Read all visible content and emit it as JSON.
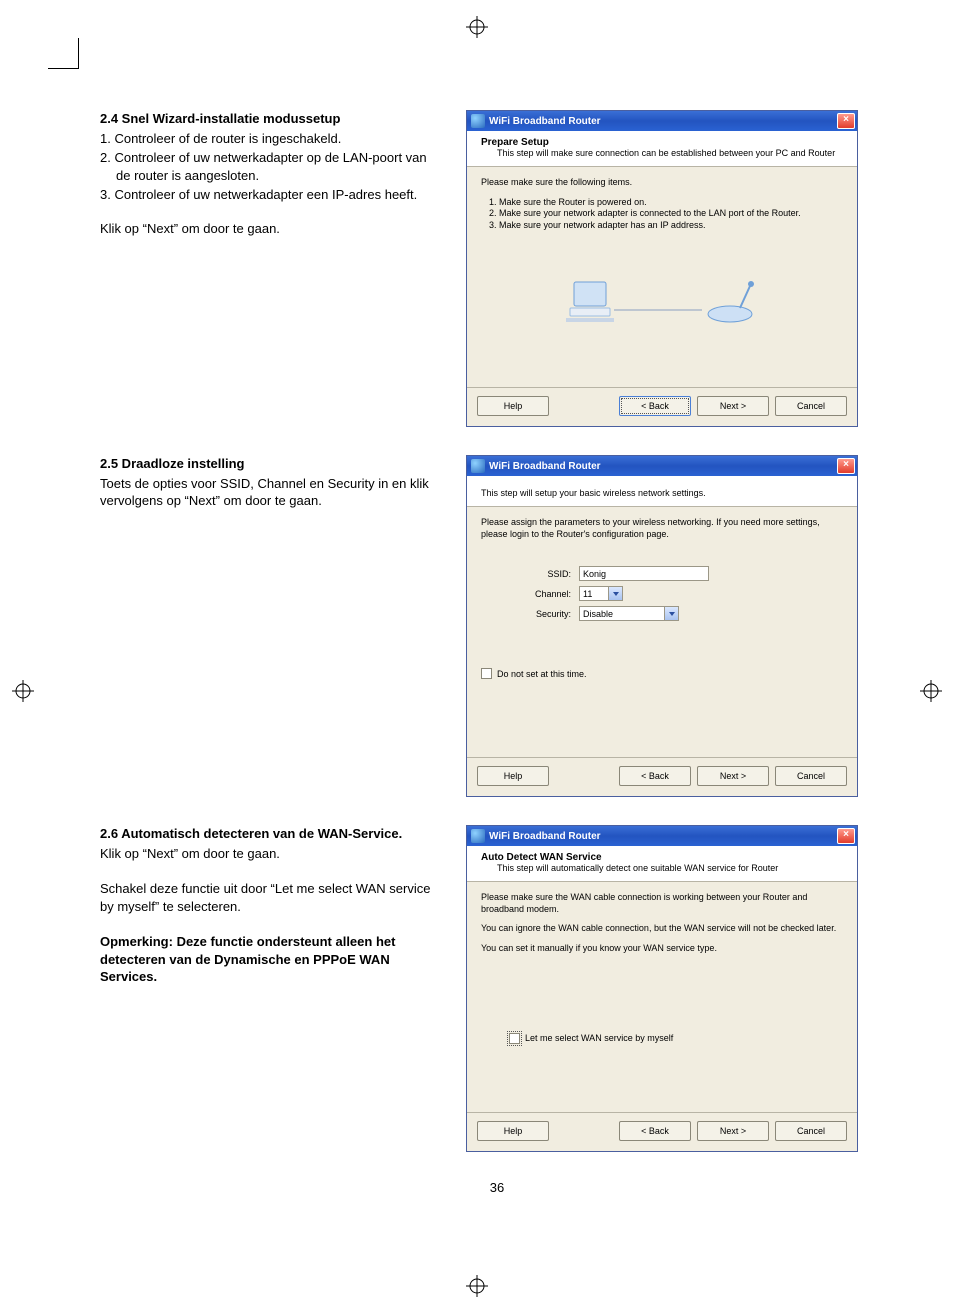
{
  "page_number": "36",
  "sections": {
    "s24": {
      "heading": "2.4 Snel Wizard-installatie modussetup",
      "items": [
        "1. Controleer of de router is ingeschakeld.",
        "2. Controleer of uw netwerkadapter op de LAN-poort van de router is aangesloten.",
        "3. Controleer of uw netwerkadapter een IP-adres heeft."
      ],
      "next": "Klik op “Next” om door te gaan."
    },
    "s25": {
      "heading": "2.5 Draadloze instelling",
      "body": "Toets de opties voor SSID, Channel en Security in en klik vervolgens op “Next” om door te gaan."
    },
    "s26": {
      "heading": "2.6 Automatisch detecteren van de WAN-Service.",
      "line1": "Klik op “Next” om door te gaan.",
      "line2": "Schakel deze functie uit door “Let me select WAN service by myself” te selecteren.",
      "note": "Opmerking: Deze functie ondersteunt alleen het detecteren van de Dynamische en PPPoE WAN Services."
    }
  },
  "dialogs": {
    "common": {
      "title": "WiFi Broadband Router",
      "help": "Help",
      "back": "< Back",
      "next": "Next >",
      "cancel": "Cancel"
    },
    "d1": {
      "header_title": "Prepare Setup",
      "header_sub": "This step will make sure connection can be established between your PC and Router",
      "lead": "Please make sure the following items.",
      "items": [
        "1. Make sure the Router is powered on.",
        "2. Make sure your network adapter is connected to the LAN port of the Router.",
        "3. Make sure your network adapter has an IP address."
      ]
    },
    "d2": {
      "header_sub": "This step will setup your basic wireless network settings.",
      "lead": "Please assign the parameters to your wireless networking. If you need more settings, please login to the Router's configuration page.",
      "labels": {
        "ssid": "SSID:",
        "channel": "Channel:",
        "security": "Security:"
      },
      "values": {
        "ssid": "Konig",
        "channel": "11",
        "security": "Disable"
      },
      "checkbox": "Do not set at this time."
    },
    "d3": {
      "header_title": "Auto Detect WAN Service",
      "header_sub": "This step will automatically detect one suitable WAN service for Router",
      "lines": [
        "Please make sure the WAN cable connection is working between your Router and broadband modem.",
        "You can ignore the WAN cable connection, but the WAN service will not be checked later.",
        "You can set it manually if you know your WAN service type."
      ],
      "checkbox": "Let me select WAN service by myself"
    }
  }
}
